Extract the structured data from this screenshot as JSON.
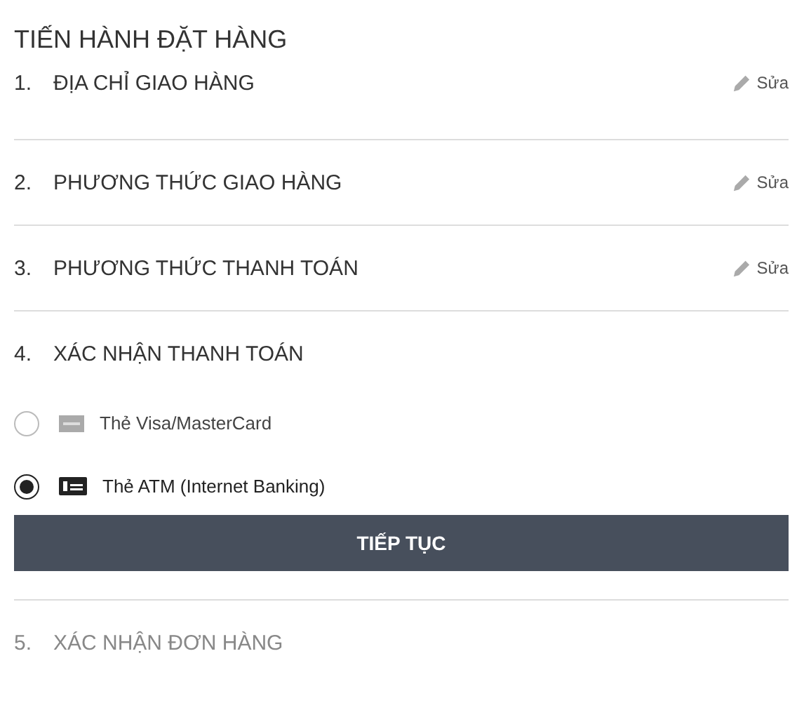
{
  "title": "TIẾN HÀNH ĐẶT HÀNG",
  "steps": [
    {
      "number": "1.",
      "title": "ĐỊA CHỈ GIAO HÀNG",
      "kind": "done",
      "edit_label": "Sửa"
    },
    {
      "number": "2.",
      "title": "PHƯƠNG THỨC GIAO HÀNG",
      "kind": "done",
      "edit_label": "Sửa"
    },
    {
      "number": "3.",
      "title": "PHƯƠNG THỨC THANH TOÁN",
      "kind": "done",
      "edit_label": "Sửa"
    },
    {
      "number": "4.",
      "title": "XÁC NHẬN THANH TOÁN",
      "kind": "current",
      "options": [
        {
          "kind": "card",
          "label": "Thẻ Visa/MasterCard",
          "selected": false
        },
        {
          "kind": "cash",
          "label": "Thẻ ATM (Internet Banking)",
          "selected": true
        }
      ],
      "button": "TIẾP TỤC"
    },
    {
      "number": "5.",
      "title": "XÁC NHẬN ĐƠN HÀNG",
      "kind": "pending"
    }
  ]
}
